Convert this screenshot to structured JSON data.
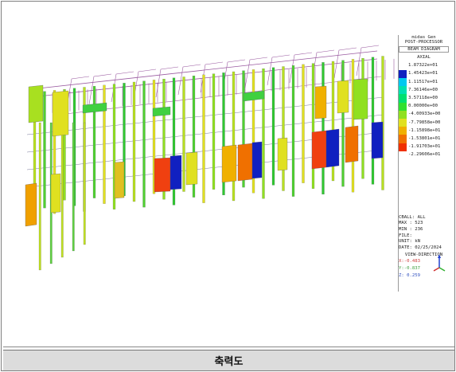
{
  "panel": {
    "app": "midas Gen",
    "mode": "POST-PROCESSOR",
    "diagram": "BEAM DIAGRAM",
    "component": "AXIAL",
    "legend": [
      {
        "value": "1.87322e+01",
        "color": "#ffffff"
      },
      {
        "value": "1.45423e+01",
        "color": "#1020c0"
      },
      {
        "value": "1.11517e+01",
        "color": "#00c8f0"
      },
      {
        "value": "7.36146e+00",
        "color": "#00e0b0"
      },
      {
        "value": "3.57118e+00",
        "color": "#00e070"
      },
      {
        "value": "0.00000e+00",
        "color": "#30e030"
      },
      {
        "value": "-4.00933e+00",
        "color": "#90e020"
      },
      {
        "value": "-7.79858e+00",
        "color": "#e0e020"
      },
      {
        "value": "-1.15898e+01",
        "color": "#f0b000"
      },
      {
        "value": "-1.53801e+01",
        "color": "#f07000"
      },
      {
        "value": "-1.91703e+01",
        "color": "#f03000"
      },
      {
        "value": "-2.29606e+01",
        "color": "#ffffff"
      }
    ],
    "cball": "CBALL: ALL",
    "max": "MAX : 523",
    "min": "MIN : 236",
    "file": "FILE:",
    "unit": "UNIT: kN",
    "date": "DATE: 02/25/2024",
    "view_title": "VIEW-DIRECTION",
    "view_x": "X:-0.483",
    "view_y": "Y:-0.837",
    "view_z": "Z: 0.259"
  },
  "caption": "축력도"
}
